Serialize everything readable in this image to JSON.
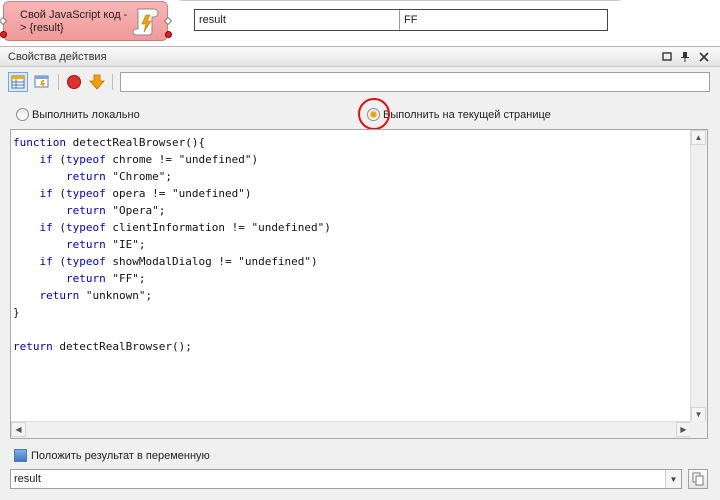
{
  "action_block": {
    "title": "Свой JavaScript код -> {result}"
  },
  "variables_table": {
    "name": "result",
    "value": "FF"
  },
  "panel": {
    "title": "Свойства действия",
    "header_buttons": [
      "minimize-icon",
      "pin-icon",
      "close-icon"
    ]
  },
  "toolbar": {
    "icons": [
      "grid-view-icon",
      "action-settings-icon",
      "stop-icon",
      "download-arrow-icon"
    ],
    "input_value": ""
  },
  "execution_mode": {
    "local_label": "Выполнить локально",
    "page_label": "Выполнить на текущей странице",
    "selected": "page"
  },
  "code": {
    "lines": [
      "function detectRealBrowser(){",
      "    if (typeof chrome != \"undefined\")",
      "        return \"Chrome\";",
      "    if (typeof opera != \"undefined\")",
      "        return \"Opera\";",
      "    if (typeof clientInformation != \"undefined\")",
      "        return \"IE\";",
      "    if (typeof showModalDialog != \"undefined\")",
      "        return \"FF\";",
      "    return \"unknown\";",
      "}",
      "",
      "return detectRealBrowser();"
    ]
  },
  "result": {
    "save_label": "Положить результат в переменную",
    "variable": "result"
  },
  "colors": {
    "keyword": "#0000cc",
    "block_fill": "#f4a7a7",
    "highlight": "#e01010",
    "radio_dot": "#f0a000"
  }
}
